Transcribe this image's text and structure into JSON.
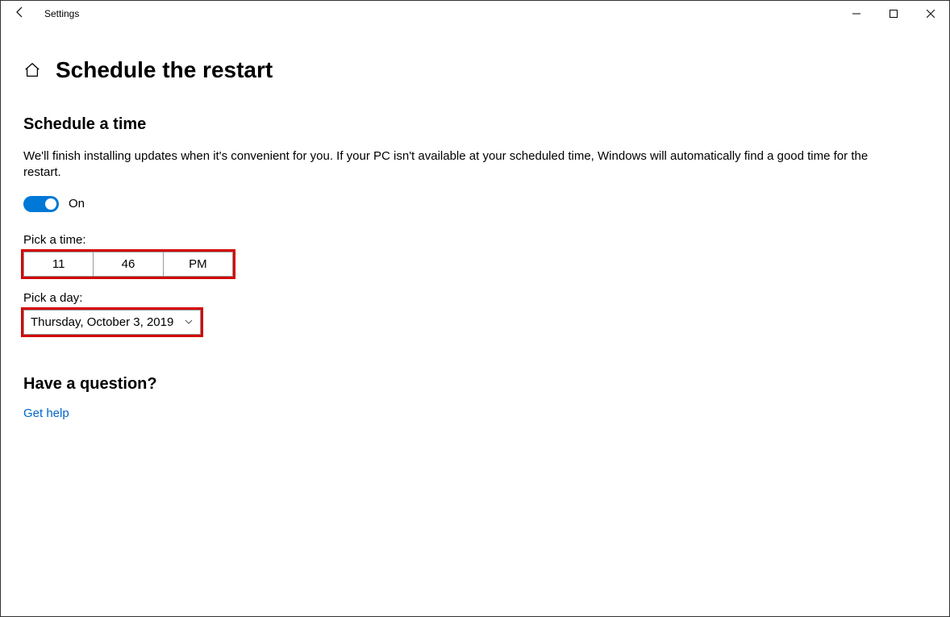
{
  "window": {
    "title": "Settings"
  },
  "page": {
    "title": "Schedule the restart"
  },
  "section": {
    "heading": "Schedule a time",
    "description": "We'll finish installing updates when it's convenient for you. If your PC isn't available at your scheduled time, Windows will automatically find a good time for the restart.",
    "toggle_label": "On",
    "pick_time_label": "Pick a time:",
    "time": {
      "hour": "11",
      "minute": "46",
      "ampm": "PM"
    },
    "pick_day_label": "Pick a day:",
    "day": "Thursday, October 3, 2019"
  },
  "help": {
    "heading": "Have a question?",
    "link": "Get help"
  }
}
